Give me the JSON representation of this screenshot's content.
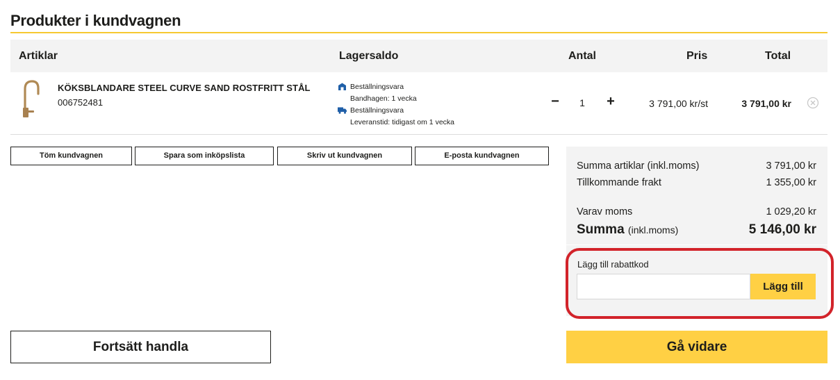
{
  "title": "Produkter i kundvagnen",
  "columns": {
    "article": "Artiklar",
    "stock": "Lagersaldo",
    "quantity": "Antal",
    "price": "Pris",
    "total": "Total"
  },
  "item": {
    "name": "KÖKSBLANDARE STEEL CURVE SAND ROSTFRITT STÅL",
    "number": "006752481",
    "store_status": "Beställningsvara",
    "store_detail": "Bandhagen: 1 vecka",
    "delivery_status": "Beställningsvara",
    "delivery_detail": "Leveranstid: tidigast om 1 vecka",
    "quantity": "1",
    "minus": "−",
    "plus": "+",
    "price": "3 791,00 kr/st",
    "total": "3 791,00 kr"
  },
  "actions": {
    "empty_cart": "Töm kundvagnen",
    "save_list": "Spara som inköpslista",
    "print_cart": "Skriv ut kundvagnen",
    "email_cart": "E-posta kundvagnen"
  },
  "summary": {
    "items_label": "Summa artiklar (inkl.moms)",
    "items_value": "3 791,00 kr",
    "shipping_label": "Tillkommande frakt",
    "shipping_value": "1 355,00 kr",
    "vat_label": "Varav moms",
    "vat_value": "1 029,20 kr",
    "total_label": "Summa",
    "total_note": "(inkl.moms)",
    "total_value": "5 146,00 kr"
  },
  "coupon": {
    "label": "Lägg till rabattkod",
    "placeholder": "",
    "button": "Lägg till"
  },
  "buttons": {
    "continue": "Fortsätt handla",
    "proceed": "Gå vidare"
  },
  "colors": {
    "accent_yellow": "#ffd044",
    "rule_yellow": "#f6c930",
    "highlight_red": "#d2232a",
    "icon_blue": "#1f5fa8"
  }
}
